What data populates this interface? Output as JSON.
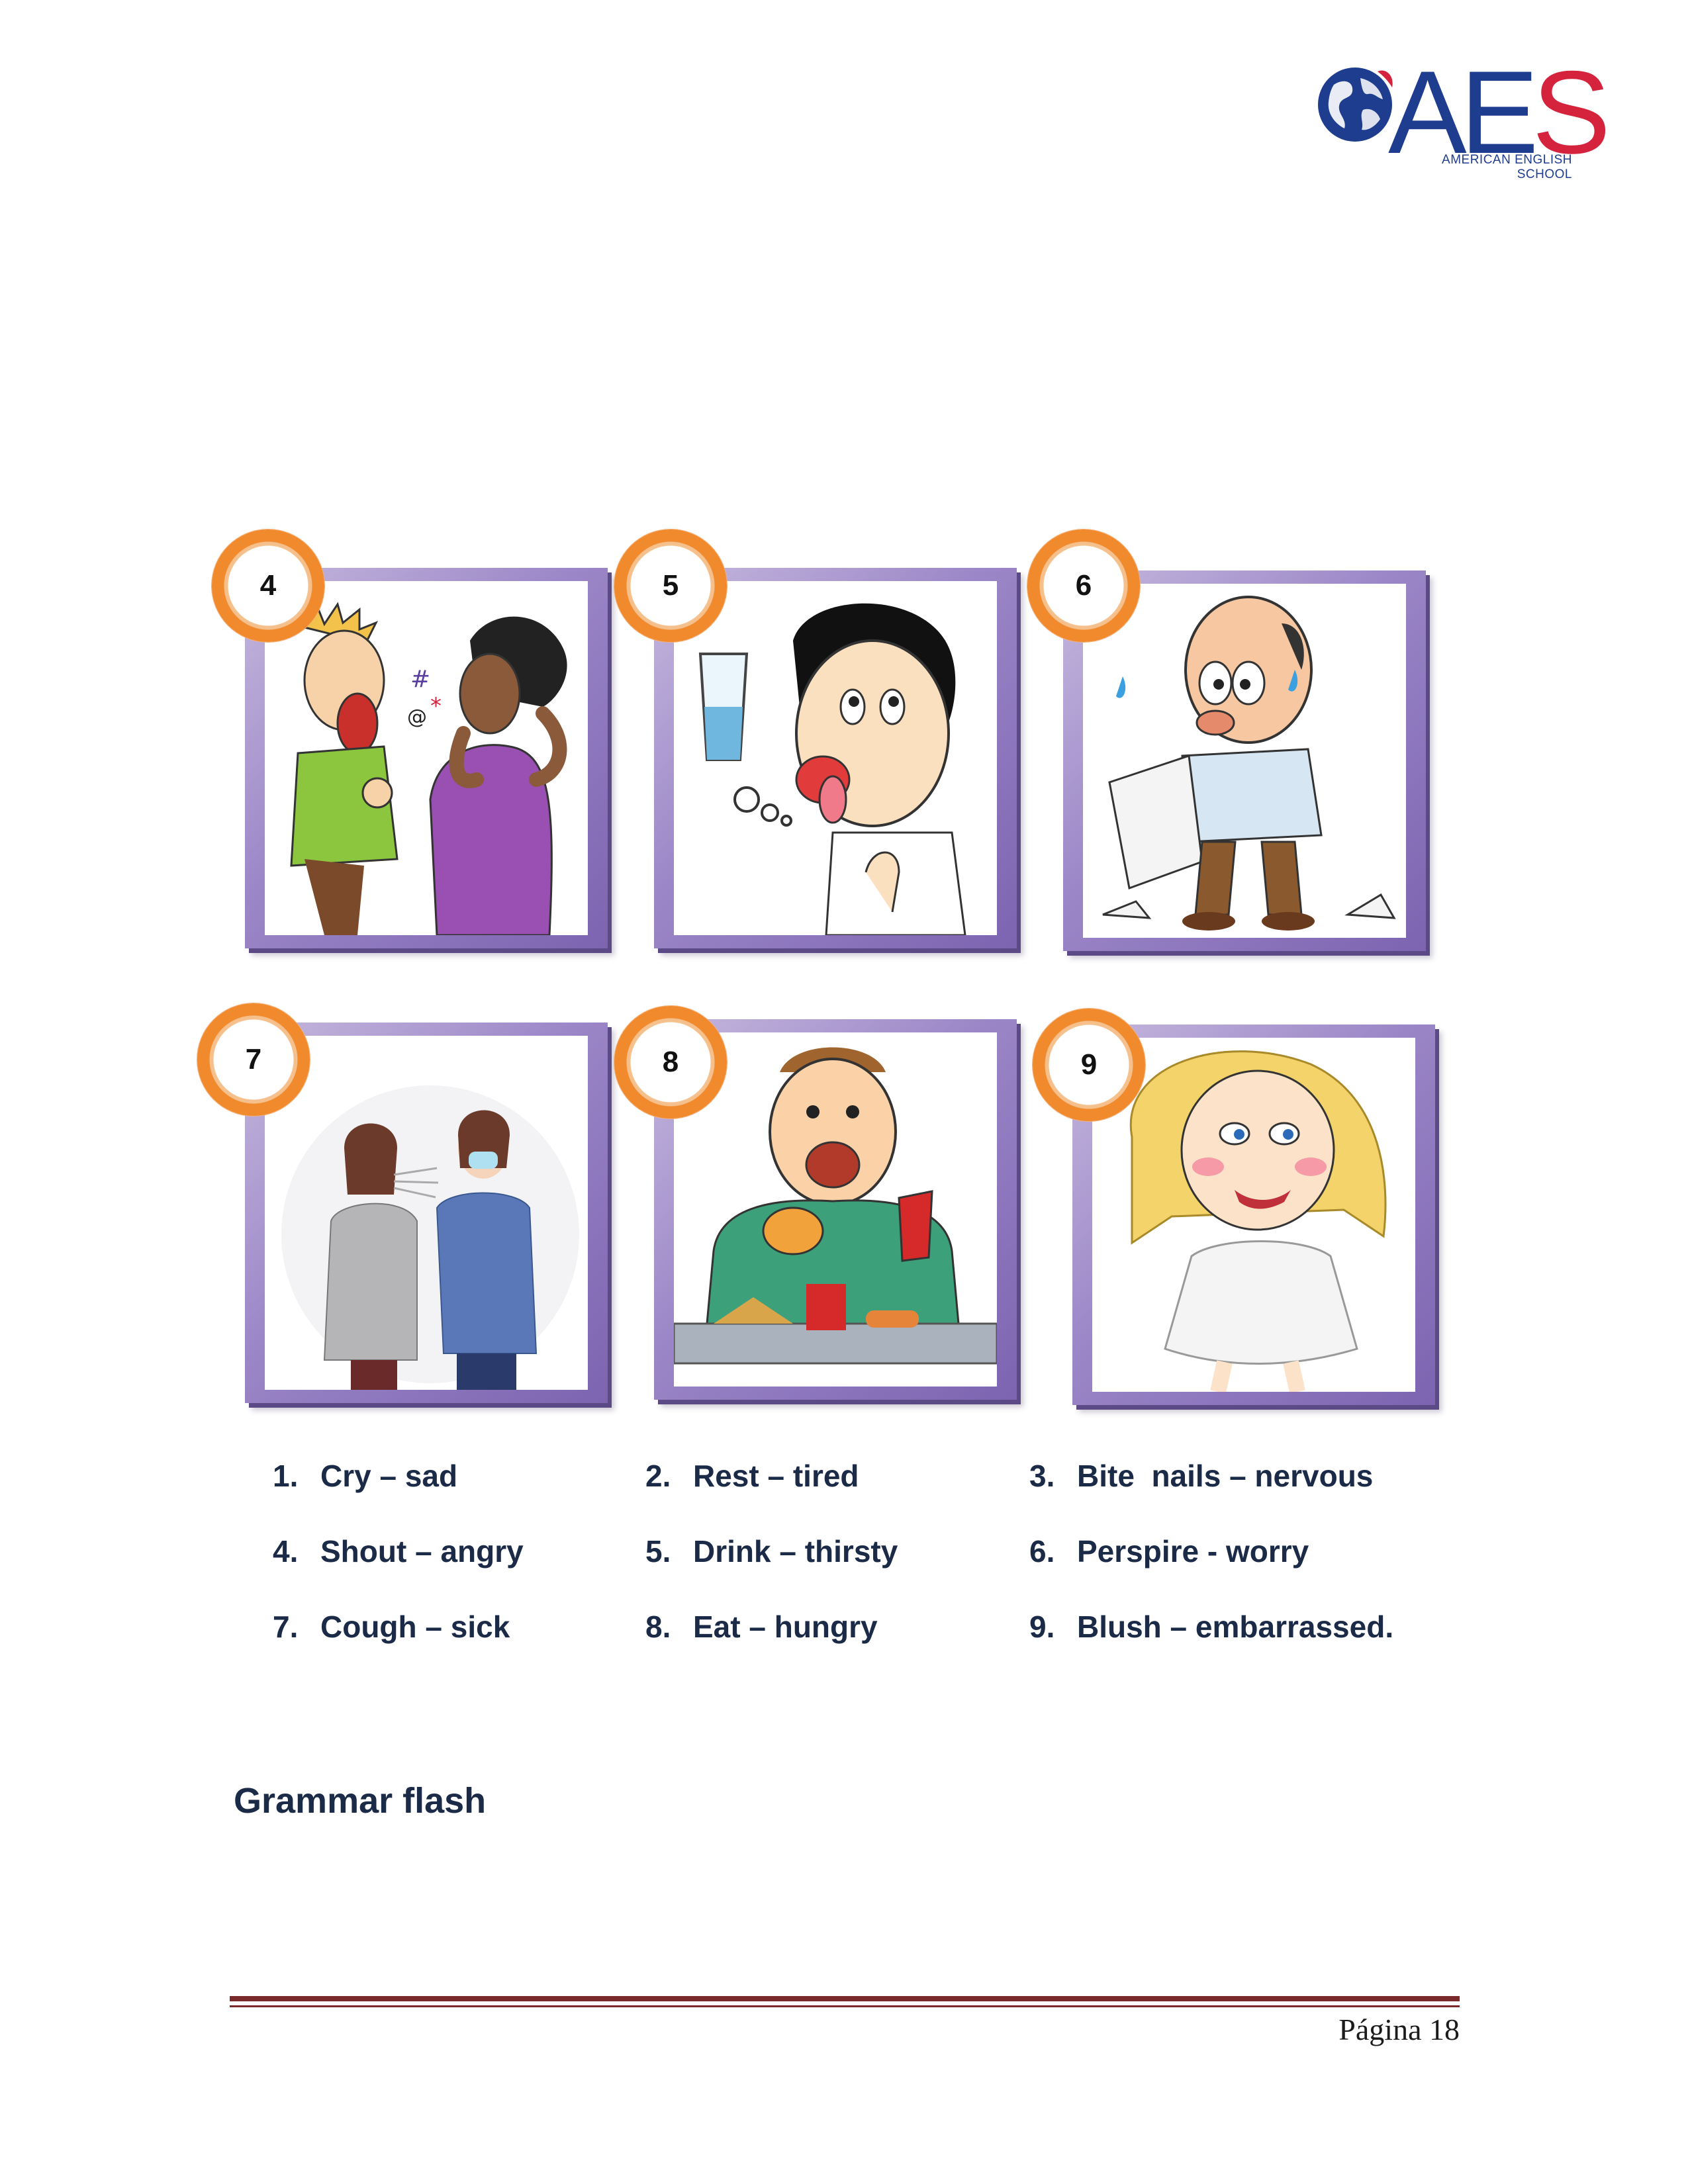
{
  "logo": {
    "word_main": "AE",
    "word_accent": "S",
    "subtitle_line1": "AMERICAN ENGLISH",
    "subtitle_line2": "SCHOOL",
    "colors": {
      "blue": "#1e3d8f",
      "red": "#d6233d"
    }
  },
  "cards": [
    {
      "number": "4",
      "icon": "shouting-angry-illustration"
    },
    {
      "number": "5",
      "icon": "thirsty-boy-water-illustration"
    },
    {
      "number": "6",
      "icon": "worried-sweating-man-illustration"
    },
    {
      "number": "7",
      "icon": "coughing-sick-woman-illustration"
    },
    {
      "number": "8",
      "icon": "hungry-man-fast-food-illustration"
    },
    {
      "number": "9",
      "icon": "blushing-embarrassed-woman-illustration"
    }
  ],
  "vocabulary": [
    {
      "num": "1.",
      "text": "Cry – sad"
    },
    {
      "num": "2.",
      "text": "Rest – tired"
    },
    {
      "num": "3.",
      "text": "Bite  nails – nervous"
    },
    {
      "num": "4.",
      "text": "Shout – angry"
    },
    {
      "num": "5.",
      "text": "Drink – thirsty"
    },
    {
      "num": "6.",
      "text": "Perspire - worry"
    },
    {
      "num": "7.",
      "text": "Cough – sick"
    },
    {
      "num": "8.",
      "text": "Eat – hungry"
    },
    {
      "num": "9.",
      "text": "Blush – embarrassed."
    }
  ],
  "section_title": "Grammar flash",
  "footer": {
    "page_label": "Página",
    "page_number": "18"
  },
  "colors": {
    "frame_purple": "#9b86c7",
    "badge_orange": "#f08a2c",
    "text_navy": "#1b2a47",
    "footer_rule": "#7a2a2a"
  }
}
